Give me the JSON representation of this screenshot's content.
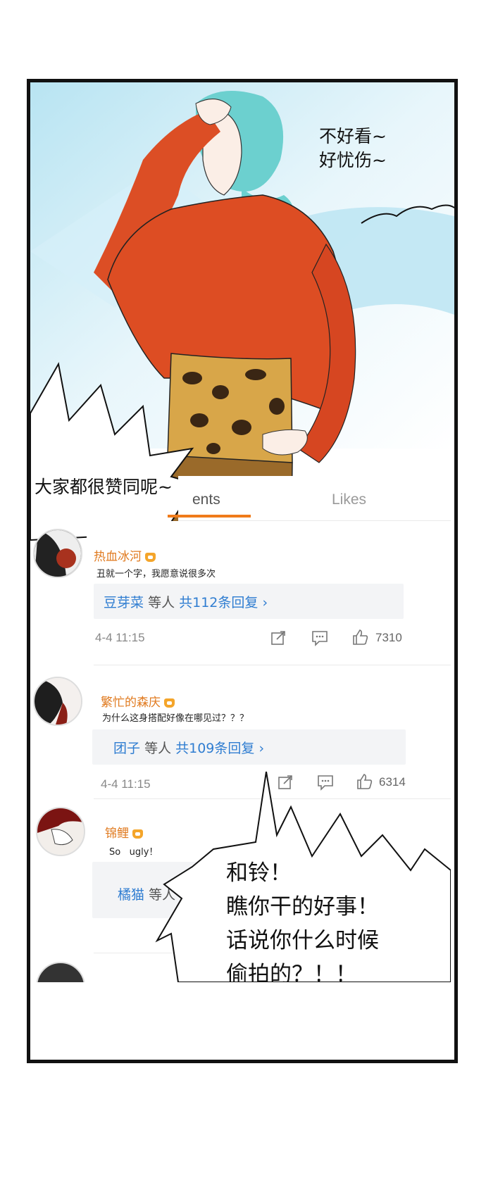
{
  "speech": {
    "top_right": [
      "不好看~",
      "好忧伤~"
    ],
    "left": "大家都很赞同呢~",
    "bottom_right": [
      "和铃！",
      "瞧你干的好事！",
      "话说你什么时候",
      "偷拍的？！！"
    ]
  },
  "tabs": {
    "comments_partial": "ents",
    "likes": "Likes"
  },
  "comments": [
    {
      "name": "热血冰河",
      "text": "丑就一个字，我愿意说很多次",
      "reply_user": "豆芽菜",
      "reply_mid": "等人",
      "reply_count": "共112条回复",
      "time": "4-4 11:15",
      "likes": "7310"
    },
    {
      "name": "繁忙的森庆",
      "text": "为什么这身搭配好像在哪见过？？？",
      "reply_user": "团子",
      "reply_mid": "等人",
      "reply_count": "共109条回复",
      "time": "4-4 11:15",
      "likes": "6314"
    },
    {
      "name": "锦鲤",
      "text": "So   ugly！",
      "reply_user": "橘猫",
      "reply_mid": "等人"
    }
  ],
  "colors": {
    "shirt": "#d94a22",
    "sky": "#9fd6ea",
    "hair": "#5fc7c7",
    "accent_orange": "#f07b1a",
    "link_blue": "#2f7dd1"
  }
}
